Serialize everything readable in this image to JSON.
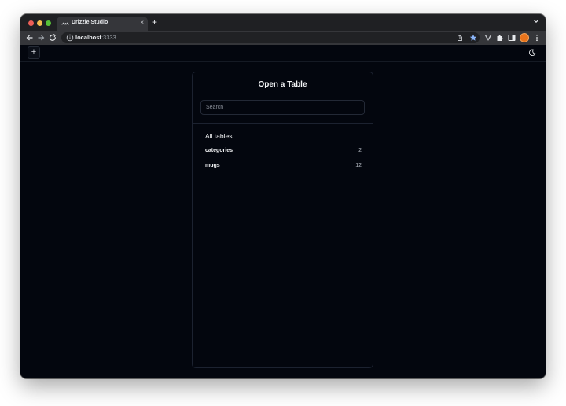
{
  "browser": {
    "tab_title": "Drizzle Studio",
    "tab_close": "×",
    "new_tab": "+",
    "url_host": "localhost",
    "url_port": ":3333",
    "profile_color": "#e8731b"
  },
  "app": {
    "add_button": "+",
    "panel_title": "Open a Table",
    "search_placeholder": "Search",
    "section_title": "All tables",
    "tables": [
      {
        "name": "categories",
        "count": "2"
      },
      {
        "name": "mugs",
        "count": "12"
      }
    ],
    "background_color": "#03060e"
  },
  "icons": [
    "back-icon",
    "forward-icon",
    "reload-icon",
    "info-icon",
    "share-icon",
    "star-icon",
    "vue-extension-icon",
    "puzzle-extension-icon",
    "side-panel-icon",
    "more-icon",
    "moon-icon",
    "chevron-down-icon"
  ]
}
